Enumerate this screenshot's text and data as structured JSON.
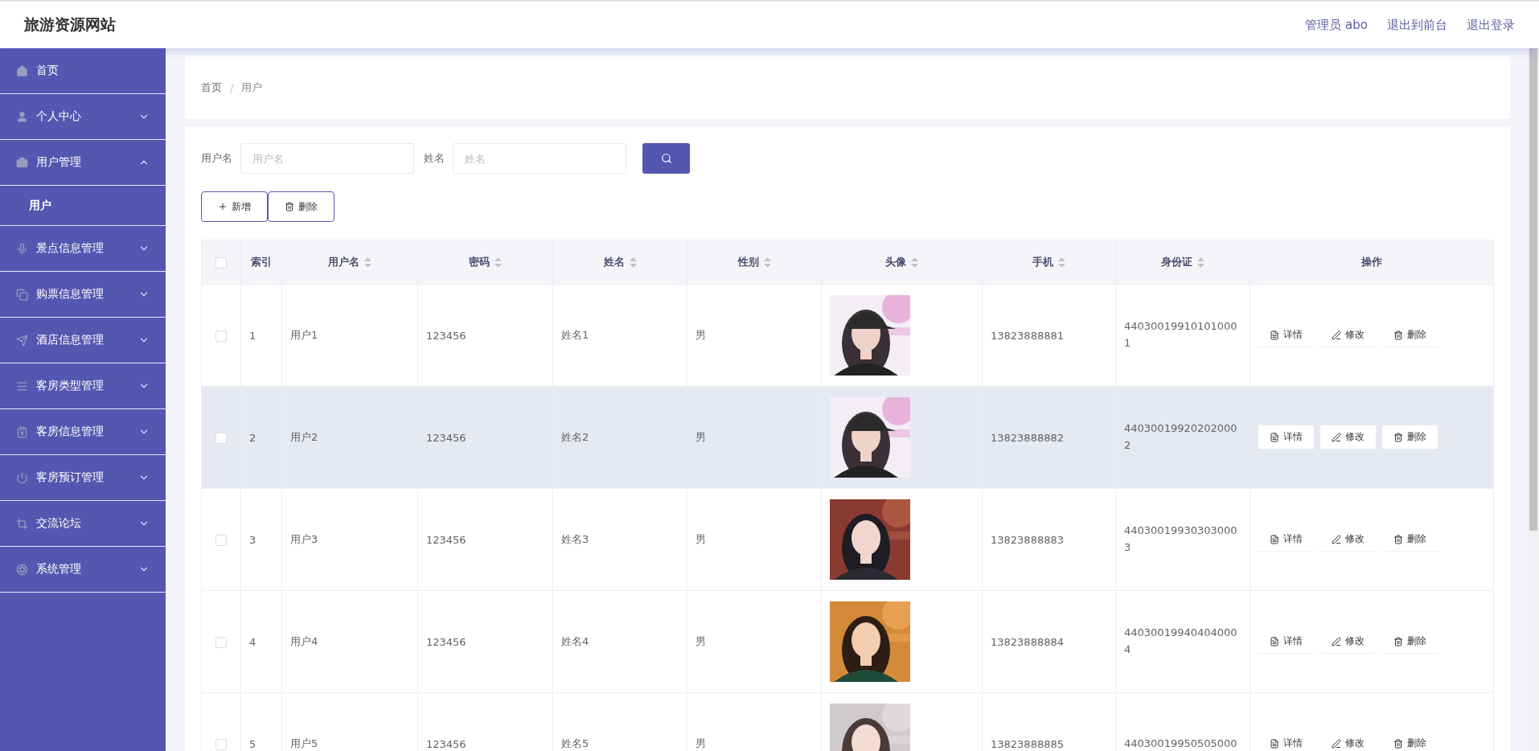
{
  "header": {
    "title": "旅游资源网站",
    "links": [
      "管理员 abo",
      "退出到前台",
      "退出登录"
    ]
  },
  "sidebar": {
    "items": [
      {
        "kind": "home",
        "label": "首页",
        "expandable": false
      },
      {
        "kind": "user",
        "label": "个人中心",
        "expandable": true,
        "expanded": false
      },
      {
        "kind": "briefcase",
        "label": "用户管理",
        "expandable": true,
        "expanded": true,
        "children": [
          {
            "label": "用户"
          }
        ]
      },
      {
        "kind": "mic",
        "label": "景点信息管理",
        "expandable": true,
        "expanded": false
      },
      {
        "kind": "copy",
        "label": "购票信息管理",
        "expandable": true,
        "expanded": false
      },
      {
        "kind": "send",
        "label": "酒店信息管理",
        "expandable": true,
        "expanded": false
      },
      {
        "kind": "lines",
        "label": "客房类型管理",
        "expandable": true,
        "expanded": false
      },
      {
        "kind": "clipboard",
        "label": "客房信息管理",
        "expandable": true,
        "expanded": false
      },
      {
        "kind": "power",
        "label": "客房预订管理",
        "expandable": true,
        "expanded": false
      },
      {
        "kind": "crop",
        "label": "交流论坛",
        "expandable": true,
        "expanded": false
      },
      {
        "kind": "aperture",
        "label": "系统管理",
        "expandable": true,
        "expanded": false
      }
    ]
  },
  "breadcrumb": {
    "separator": "/",
    "items": [
      "首页",
      "用户"
    ]
  },
  "filters": [
    {
      "label": "用户名",
      "placeholder": "用户名"
    },
    {
      "label": "姓名",
      "placeholder": "姓名"
    }
  ],
  "toolbar": [
    {
      "kind": "add",
      "label": "新增"
    },
    {
      "kind": "delete",
      "label": "删除"
    }
  ],
  "table": {
    "select_all": {
      "checked": false
    },
    "columns": [
      {
        "label": "索引",
        "sortable": false
      },
      {
        "label": "用户名",
        "sortable": true
      },
      {
        "label": "密码",
        "sortable": true
      },
      {
        "label": "姓名",
        "sortable": true
      },
      {
        "label": "性别",
        "sortable": true
      },
      {
        "label": "头像",
        "sortable": true
      },
      {
        "label": "手机",
        "sortable": true
      },
      {
        "label": "身份证",
        "sortable": true
      },
      {
        "label": "操作",
        "sortable": false
      }
    ],
    "rows": [
      {
        "checked": false,
        "hovered": false,
        "index": "1",
        "username": "用户1",
        "password": "123456",
        "name": "姓名1",
        "gender": "男",
        "phone": "13823888881",
        "id_card": "440300199101010001",
        "actions": [
          {
            "kind": "detail",
            "label": "详情"
          },
          {
            "kind": "edit",
            "label": "修改"
          },
          {
            "kind": "delete",
            "label": "删除"
          }
        ]
      },
      {
        "checked": false,
        "hovered": true,
        "index": "2",
        "username": "用户2",
        "password": "123456",
        "name": "姓名2",
        "gender": "男",
        "phone": "13823888882",
        "id_card": "440300199202020002",
        "actions": [
          {
            "kind": "detail",
            "label": "详情"
          },
          {
            "kind": "edit",
            "label": "修改"
          },
          {
            "kind": "delete",
            "label": "删除"
          }
        ]
      },
      {
        "checked": false,
        "hovered": false,
        "index": "3",
        "username": "用户3",
        "password": "123456",
        "name": "姓名3",
        "gender": "男",
        "phone": "13823888883",
        "id_card": "440300199303030003",
        "actions": [
          {
            "kind": "detail",
            "label": "详情"
          },
          {
            "kind": "edit",
            "label": "修改"
          },
          {
            "kind": "delete",
            "label": "删除"
          }
        ]
      },
      {
        "checked": false,
        "hovered": false,
        "index": "4",
        "username": "用户4",
        "password": "123456",
        "name": "姓名4",
        "gender": "男",
        "phone": "13823888884",
        "id_card": "440300199404040004",
        "actions": [
          {
            "kind": "detail",
            "label": "详情"
          },
          {
            "kind": "edit",
            "label": "修改"
          },
          {
            "kind": "delete",
            "label": "删除"
          }
        ]
      },
      {
        "checked": false,
        "hovered": false,
        "index": "5",
        "username": "用户5",
        "password": "123456",
        "name": "姓名5",
        "gender": "男",
        "phone": "13823888885",
        "id_card": "44030019950505000",
        "actions": [
          {
            "kind": "detail",
            "label": "详情"
          },
          {
            "kind": "edit",
            "label": "修改"
          },
          {
            "kind": "delete",
            "label": "删除"
          }
        ]
      }
    ]
  }
}
